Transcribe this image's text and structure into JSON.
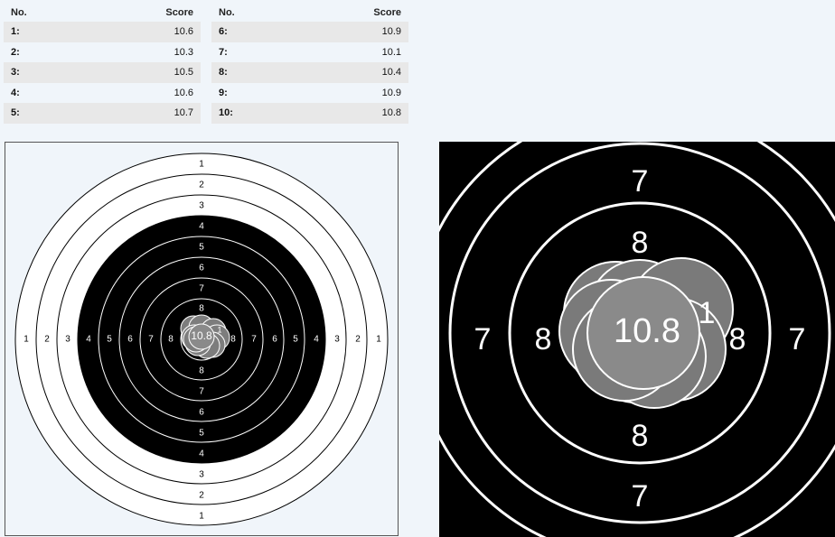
{
  "table": {
    "header_no": "No.",
    "header_score": "Score",
    "left_rows": [
      {
        "no": "1:",
        "score": "10.6"
      },
      {
        "no": "2:",
        "score": "10.3"
      },
      {
        "no": "3:",
        "score": "10.5"
      },
      {
        "no": "4:",
        "score": "10.6"
      },
      {
        "no": "5:",
        "score": "10.7"
      }
    ],
    "right_rows": [
      {
        "no": "6:",
        "score": "10.9"
      },
      {
        "no": "7:",
        "score": "10.1"
      },
      {
        "no": "8:",
        "score": "10.4"
      },
      {
        "no": "9:",
        "score": "10.9"
      },
      {
        "no": "10:",
        "score": "10.8"
      }
    ]
  },
  "target": {
    "ring_labels": [
      "1",
      "2",
      "3",
      "4",
      "5",
      "6",
      "7",
      "8"
    ],
    "last_shot_label": "10.8",
    "zoom_ring_labels": [
      "7",
      "8"
    ],
    "zoom_partial_label": "1",
    "colors": {
      "black": "#000000",
      "white": "#ffffff",
      "shot": "#808080",
      "shot_last": "#8c8c8c"
    }
  }
}
